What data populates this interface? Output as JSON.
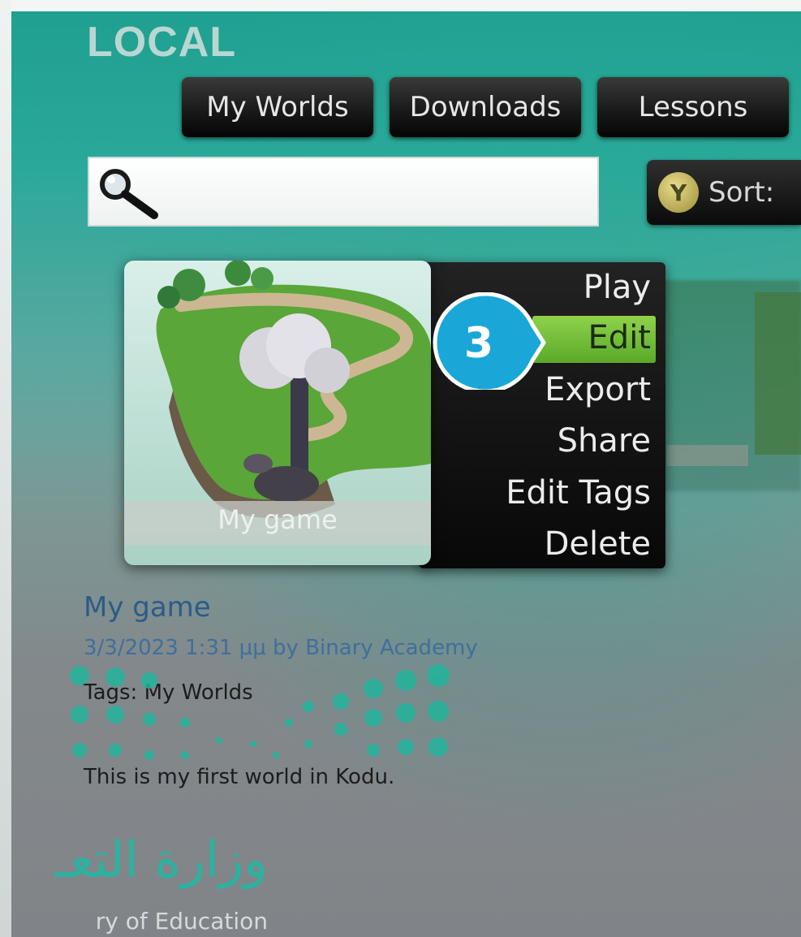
{
  "section": {
    "title": "LOCAL"
  },
  "tabs": [
    {
      "label": "My Worlds"
    },
    {
      "label": "Downloads"
    },
    {
      "label": "Lessons"
    }
  ],
  "search": {
    "placeholder": "",
    "value": ""
  },
  "sort": {
    "button_glyph": "Y",
    "label": "Sort:"
  },
  "world_card": {
    "thumbnail_caption": "My game"
  },
  "context_menu": {
    "items": [
      {
        "label": "Play"
      },
      {
        "label": "Edit"
      },
      {
        "label": "Export"
      },
      {
        "label": "Share"
      },
      {
        "label": "Edit Tags"
      },
      {
        "label": "Delete"
      }
    ],
    "selected": "Edit"
  },
  "callout": {
    "number": "3"
  },
  "world_details": {
    "title": "My game",
    "meta": "3/3/2023 1:31 μμ by Binary Academy",
    "tags": "Tags: My Worlds",
    "description": "This is my first world in Kodu."
  },
  "watermark": {
    "arabic_text": "وزارة التعـ",
    "english_text": "ry of Education"
  },
  "colors": {
    "background_top": "#1f9f8f",
    "menu_highlight": "#7cc63b",
    "callout": "#1aa7d8",
    "title_blue": "#2a5c8a",
    "watermark_teal": "#29b3a0"
  }
}
